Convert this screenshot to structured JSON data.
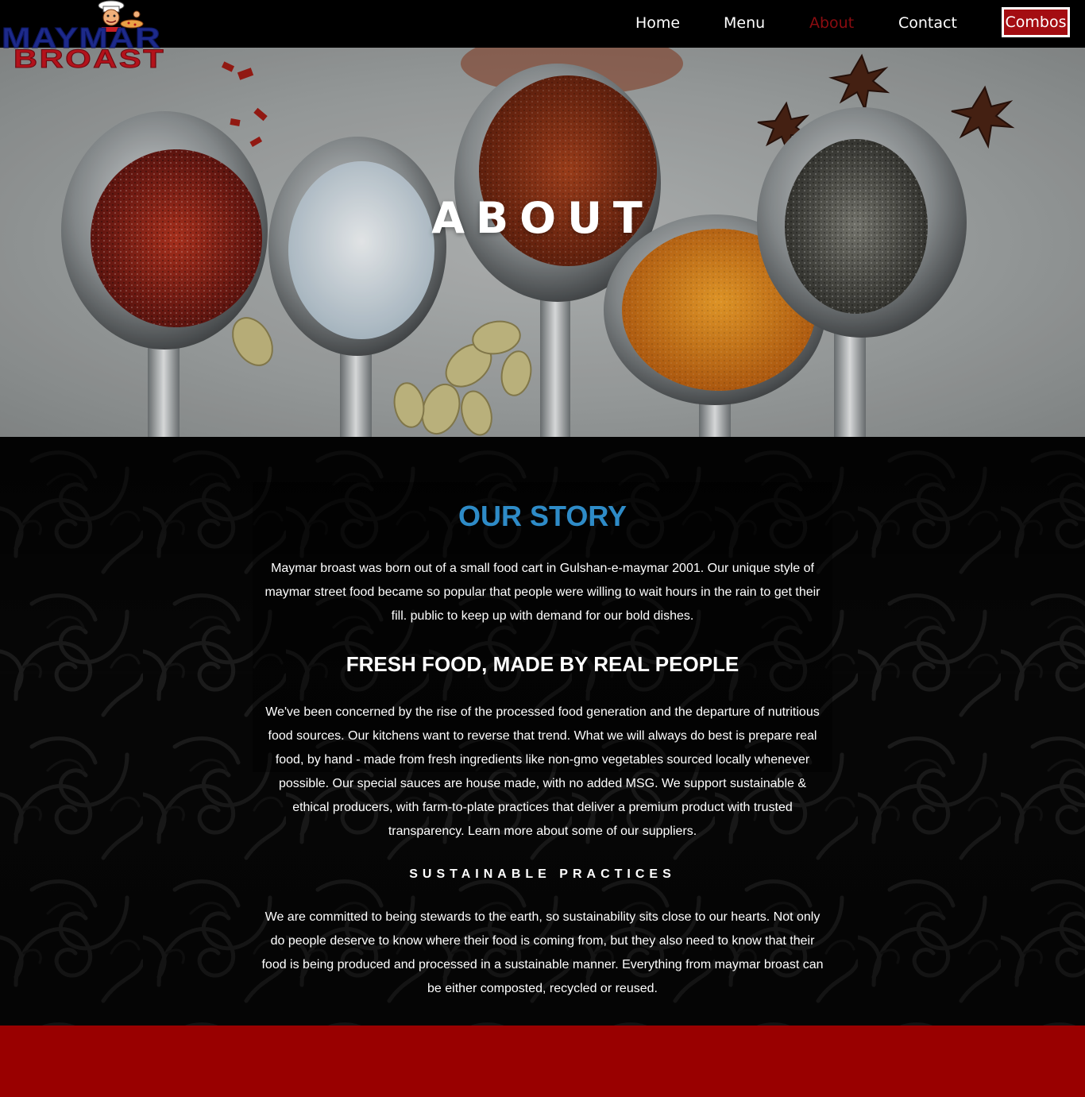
{
  "brand": {
    "line1": "MAYMAR",
    "line2": "BROAST"
  },
  "nav": {
    "home": "Home",
    "menu": "Menu",
    "about": "About",
    "contact": "Contact",
    "combos": "Combos"
  },
  "hero": {
    "title": "ABOUT"
  },
  "story": {
    "title": "OUR STORY",
    "paragraph1": "Maymar broast was born out of a small food cart in Gulshan-e-maymar 2001. Our unique style of maymar street food became so popular that people were willing to wait hours in the rain to get their fill. public to keep up with demand for our bold dishes.",
    "fresh_title": "FRESH FOOD, MADE BY REAL PEOPLE",
    "paragraph2": "We've been concerned by the rise of the processed food generation and the departure of nutritious food sources. Our kitchens want to reverse that trend. What we will always do best is prepare real food, by hand - made from fresh ingredients like non-gmo vegetables sourced locally whenever possible. Our special sauces are house made, with no added MSG. We support sustainable & ethical producers, with farm-to-plate practices that deliver a premium product with trusted transparency. Learn more about some of our suppliers.",
    "sustainable_title": "SUSTAINABLE PRACTICES",
    "paragraph3": "We are committed to being stewards to the earth, so sustainability sits close to our hearts. Not only do people deserve to know where their food is coming from, but they also need to know that their food is being produced and processed in a sustainable manner. Everything from maymar broast can be either composted, recycled or reused."
  },
  "colors": {
    "nav_bg": "#000000",
    "active_nav": "#8b0c10",
    "combos_bg": "#a40d12",
    "story_title": "#2e8bc7",
    "footer_bg": "#990000"
  }
}
